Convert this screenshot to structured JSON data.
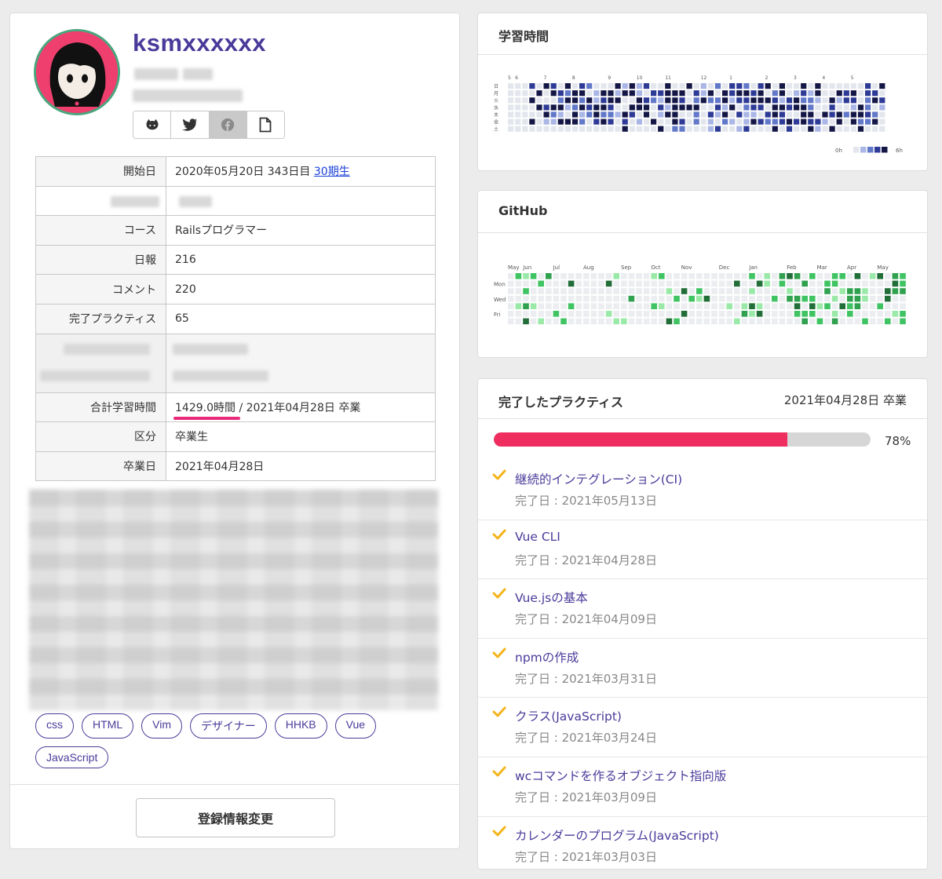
{
  "profile": {
    "login_name": "ksmxxxxxx",
    "sns": [
      {
        "icon": "github-icon"
      },
      {
        "icon": "twitter-icon"
      },
      {
        "icon": "facebook-icon"
      },
      {
        "icon": "document-icon"
      }
    ],
    "info": {
      "start": {
        "label": "開始日",
        "value": "2020年05月20日 343日目 ",
        "link": "30期生"
      },
      "course": {
        "label": "コース",
        "value": "Railsプログラマー"
      },
      "reports": {
        "label": "日報",
        "value": "216"
      },
      "comments": {
        "label": "コメント",
        "value": "220"
      },
      "practices": {
        "label": "完了プラクティス",
        "value": "65"
      },
      "total_time": {
        "label": "合計学習時間",
        "hours": "1429.0時間",
        "rest": " / 2021年04月28日 卒業"
      },
      "category": {
        "label": "区分",
        "value": "卒業生"
      },
      "graduation": {
        "label": "卒業日",
        "value": "2021年04月28日"
      }
    },
    "tags": [
      "css",
      "HTML",
      "Vim",
      "デザイナー",
      "HHKB",
      "Vue",
      "JavaScript"
    ],
    "edit_button": "登録情報変更"
  },
  "study": {
    "title": "学習時間",
    "months": [
      "5",
      "6",
      "7",
      "8",
      "9",
      "10",
      "11",
      "12",
      "1",
      "2",
      "3",
      "4",
      "5"
    ],
    "weekdays": [
      "日",
      "月",
      "火",
      "水",
      "木",
      "金",
      "土"
    ],
    "legend_min": "0h",
    "legend_max": "6h",
    "colors": [
      "#e3e6ec",
      "#a9b6e6",
      "#6278c9",
      "#2d3a96",
      "#141746"
    ]
  },
  "github": {
    "title": "GitHub",
    "months": [
      "May",
      "Jun",
      "Jul",
      "Aug",
      "Sep",
      "Oct",
      "Nov",
      "Dec",
      "Jan",
      "Feb",
      "Mar",
      "Apr",
      "May"
    ],
    "weekdays": [
      "Mon",
      "Wed",
      "Fri"
    ],
    "colors": [
      "#ebedf0",
      "#9be9a8",
      "#40c463",
      "#30a14e",
      "#216e39"
    ]
  },
  "practices": {
    "title": "完了したプラクティス",
    "graduation_note": "2021年04月28日 卒業",
    "progress": 78,
    "progress_label": "78%",
    "items": [
      {
        "title": "継続的インテグレーション(CI)",
        "date": "完了日 : 2021年05月13日"
      },
      {
        "title": "Vue CLI",
        "date": "完了日 : 2021年04月28日"
      },
      {
        "title": "Vue.jsの基本",
        "date": "完了日 : 2021年04月09日"
      },
      {
        "title": "npmの作成",
        "date": "完了日 : 2021年03月31日"
      },
      {
        "title": "クラス(JavaScript)",
        "date": "完了日 : 2021年03月24日"
      },
      {
        "title": "wcコマンドを作るオブジェクト指向版",
        "date": "完了日 : 2021年03月09日"
      },
      {
        "title": "カレンダーのプログラム(JavaScript)",
        "date": "完了日 : 2021年03月03日"
      }
    ]
  }
}
